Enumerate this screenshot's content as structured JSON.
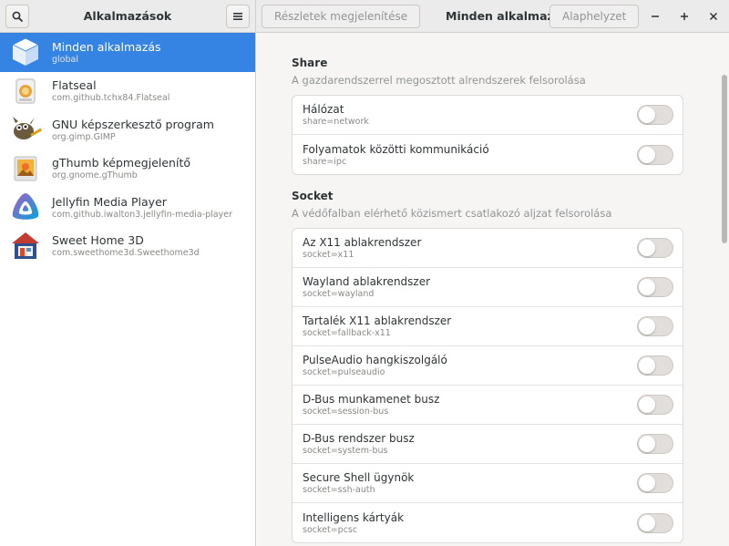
{
  "header": {
    "sidebar_title": "Alkalmazások",
    "details_label": "Részletek megjelenítése",
    "main_title": "Minden alkalmazás",
    "reset_label": "Alaphelyzet",
    "search_icon": "search-icon",
    "menu_icon": "hamburger-menu-icon"
  },
  "window_controls": {
    "minimize": "–",
    "maximize": "+",
    "close": "✕"
  },
  "sidebar": {
    "items": [
      {
        "name": "Minden alkalmazás",
        "id": "global",
        "icon": "cube-icon",
        "selected": true
      },
      {
        "name": "Flatseal",
        "id": "com.github.tchx84.Flatseal",
        "icon": "flatseal-icon"
      },
      {
        "name": "GNU képszerkesztő program",
        "id": "org.gimp.GIMP",
        "icon": "gimp-icon"
      },
      {
        "name": "gThumb képmegjelenítő",
        "id": "org.gnome.gThumb",
        "icon": "gthumb-icon"
      },
      {
        "name": "Jellyfin Media Player",
        "id": "com.github.iwalton3.jellyfin-media-player",
        "icon": "jellyfin-icon"
      },
      {
        "name": "Sweet Home 3D",
        "id": "com.sweethome3d.Sweethome3d",
        "icon": "sweethome-icon"
      }
    ]
  },
  "sections": [
    {
      "title": "Share",
      "description": "A gazdarendszerrel megosztott alrendszerek felsorolása",
      "rows": [
        {
          "title": "Hálózat",
          "key": "share=network",
          "enabled": false
        },
        {
          "title": "Folyamatok közötti kommunikáció",
          "key": "share=ipc",
          "enabled": false
        }
      ]
    },
    {
      "title": "Socket",
      "description": "A védőfalban elérhető közismert csatlakozó aljzat felsorolása",
      "rows": [
        {
          "title": "Az X11 ablakrendszer",
          "key": "socket=x11",
          "enabled": false
        },
        {
          "title": "Wayland ablakrendszer",
          "key": "socket=wayland",
          "enabled": false
        },
        {
          "title": "Tartalék X11 ablakrendszer",
          "key": "socket=fallback-x11",
          "enabled": false
        },
        {
          "title": "PulseAudio hangkiszolgáló",
          "key": "socket=pulseaudio",
          "enabled": false
        },
        {
          "title": "D-Bus munkamenet busz",
          "key": "socket=session-bus",
          "enabled": false
        },
        {
          "title": "D-Bus rendszer busz",
          "key": "socket=system-bus",
          "enabled": false
        },
        {
          "title": "Secure Shell ügynök",
          "key": "socket=ssh-auth",
          "enabled": false
        },
        {
          "title": "Intelligens kártyák",
          "key": "socket=pcsc",
          "enabled": false
        }
      ]
    }
  ],
  "colors": {
    "accent": "#3584e4",
    "switch_off": "#e1dedb"
  }
}
